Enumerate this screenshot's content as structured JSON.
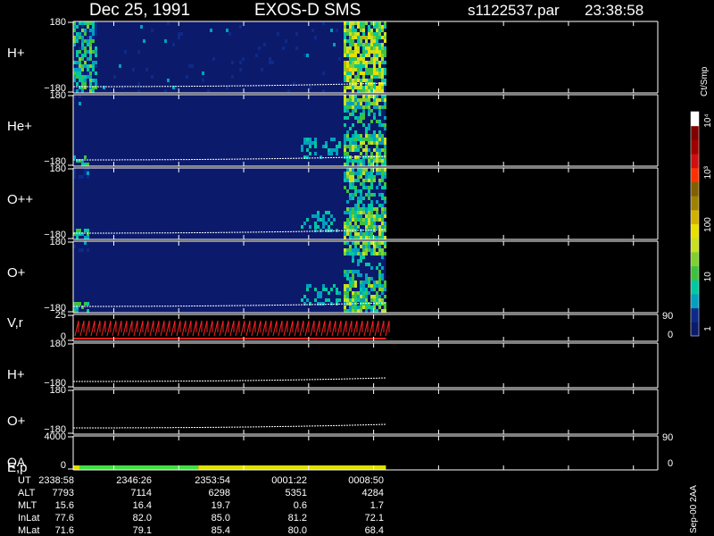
{
  "header": {
    "date": "Dec 25, 1991",
    "mission": "EXOS-D SMS",
    "file": "s1122537.par",
    "time": "23:38:58"
  },
  "footer_note": "Sep-00 2AA",
  "colorbar": {
    "label": "Ct/Smp",
    "ticks": [
      {
        "label": "1",
        "value": 1
      },
      {
        "label": "10",
        "value": 10
      },
      {
        "label": "100",
        "value": 100
      },
      {
        "label": "10³",
        "value": 1000
      },
      {
        "label": "10⁴",
        "value": 10000
      }
    ],
    "colors": [
      "#0c1a6b",
      "#0c2a8a",
      "#00a0c0",
      "#00c8a0",
      "#40c040",
      "#80d030",
      "#c8e020",
      "#e8e000",
      "#d4b000",
      "#a08000",
      "#806000",
      "#ff3000",
      "#d01010",
      "#a00000",
      "#800000",
      "#ffffff"
    ]
  },
  "panels": [
    {
      "label": "H+",
      "y_top": "180",
      "y_bottom": "−180"
    },
    {
      "label": "He+",
      "y_top": "180",
      "y_bottom": "−180"
    },
    {
      "label": "O++",
      "y_top": "180",
      "y_bottom": "−180"
    },
    {
      "label": "O+",
      "y_top": "180",
      "y_bottom": "−180"
    },
    {
      "label": "V,r",
      "y_top": "25",
      "y_bottom": "0",
      "right_top": "90",
      "right_bottom": "0"
    },
    {
      "label": "H+",
      "y_top": "180",
      "y_bottom": "−180"
    },
    {
      "label": "O+",
      "y_top": "180",
      "y_bottom": "−180"
    },
    {
      "label": "E,p",
      "label2": "QA",
      "y_top": "4000",
      "y_bottom": "0",
      "right_top": "90",
      "right_bottom": "0"
    }
  ],
  "table": {
    "row_labels": [
      "UT",
      "ALT",
      "MLT",
      "InLat",
      "MLat"
    ],
    "columns": [
      [
        "2338:58",
        "7793",
        "15.6",
        "77.6",
        "71.6"
      ],
      [
        "2346:26",
        "7114",
        "16.4",
        "82.0",
        "79.1"
      ],
      [
        "2353:54",
        "6298",
        "19.7",
        "85.0",
        "85.4"
      ],
      [
        "0001:22",
        "5351",
        "0.6",
        "81.2",
        "80.0"
      ],
      [
        "0008:50",
        "4284",
        "1.7",
        "72.1",
        "68.4"
      ]
    ]
  },
  "chart_data": {
    "type": "heatmap",
    "title": "Dec 25, 1991 EXOS-D SMS",
    "time_ticks": [
      "2338:58",
      "2346:26",
      "2353:54",
      "0001:22",
      "0008:50"
    ],
    "colorbar_unit": "Ct/Smp",
    "colorbar_range": [
      1,
      10000
    ],
    "colorbar_scale": "log",
    "qa_bar_segments": [
      {
        "color": "#e0e000",
        "fraction": 0.02
      },
      {
        "color": "#40e040",
        "fraction": 0.38
      },
      {
        "color": "#e0e000",
        "fraction": 0.6
      }
    ],
    "data_end_fraction": 0.535,
    "series": [
      {
        "name": "H+",
        "ylim": [
          -180,
          180
        ]
      },
      {
        "name": "He+",
        "ylim": [
          -180,
          180
        ]
      },
      {
        "name": "O++",
        "ylim": [
          -180,
          180
        ]
      },
      {
        "name": "O+",
        "ylim": [
          -180,
          180
        ]
      },
      {
        "name": "V,r",
        "ylim": [
          0,
          25
        ]
      },
      {
        "name": "H+",
        "ylim": [
          -180,
          180
        ]
      },
      {
        "name": "O+",
        "ylim": [
          -180,
          180
        ]
      },
      {
        "name": "E,p",
        "ylim": [
          0,
          4000
        ]
      }
    ]
  }
}
